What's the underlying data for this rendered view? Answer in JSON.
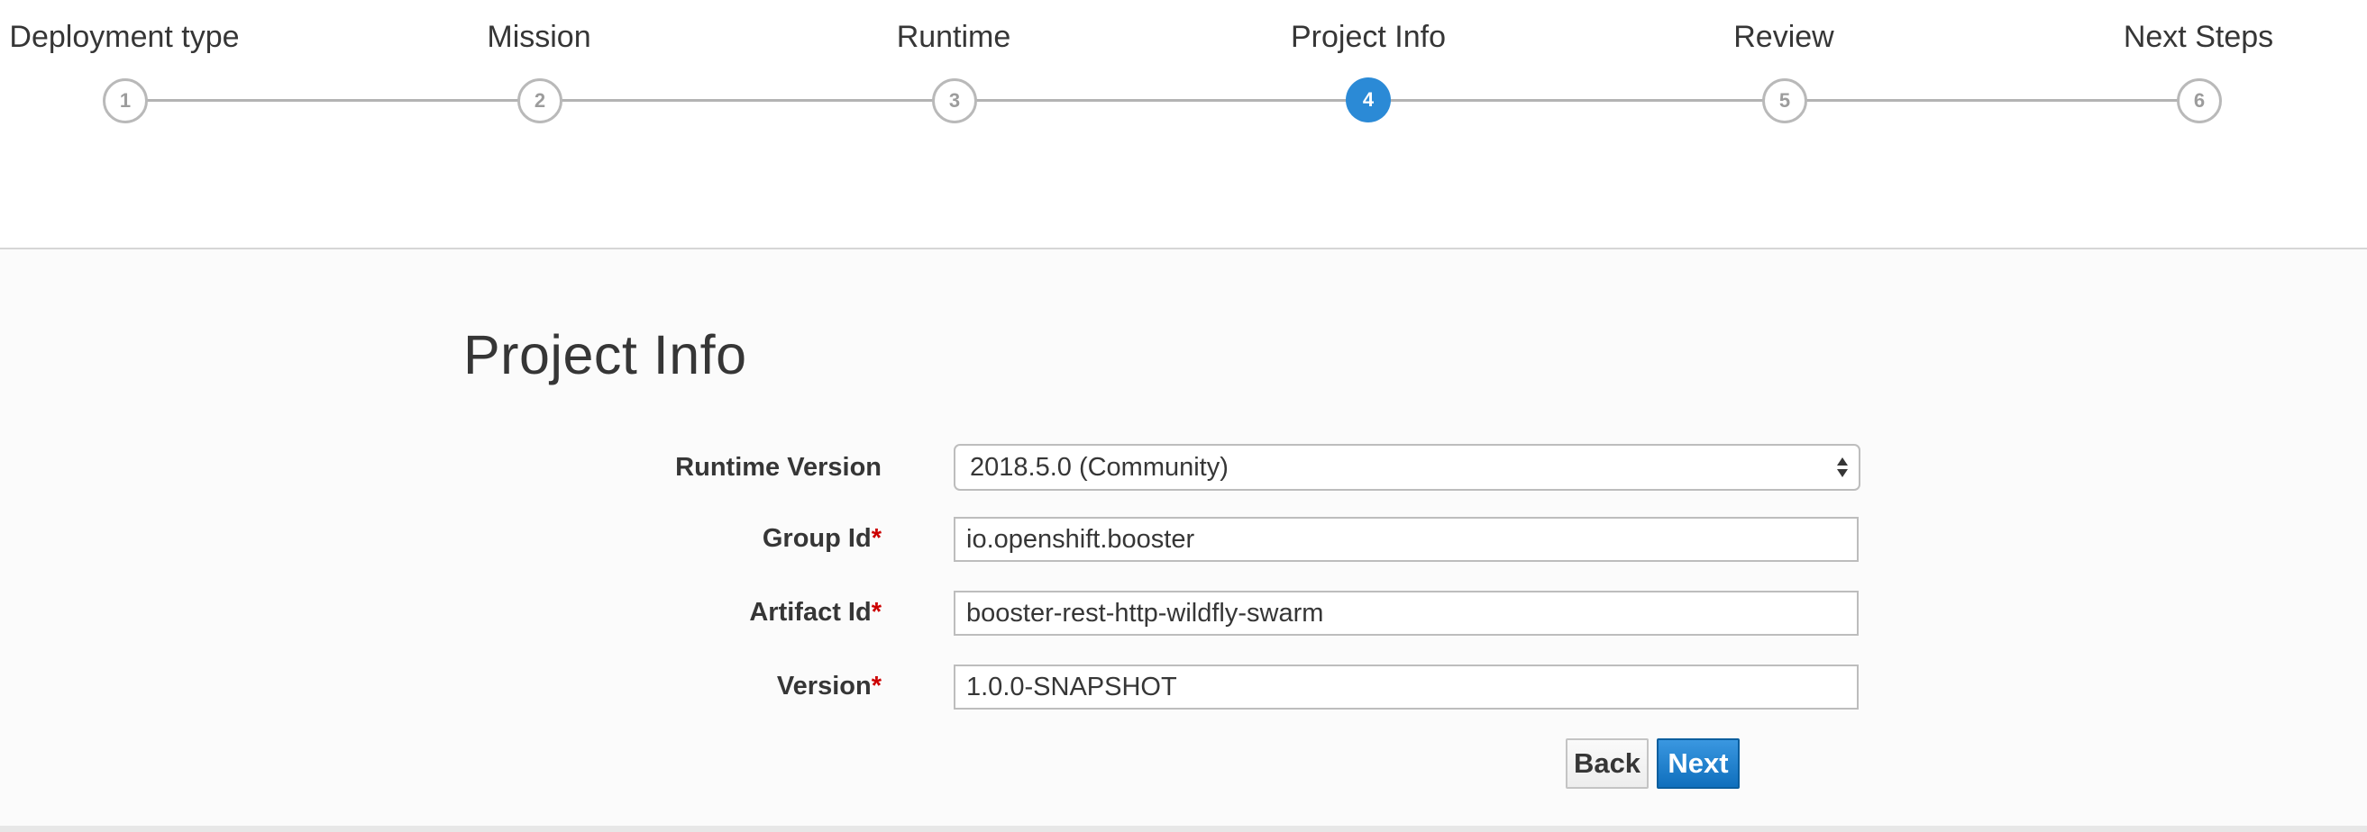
{
  "wizard": {
    "steps": [
      {
        "label": "Deployment type",
        "number": "1",
        "active": false
      },
      {
        "label": "Mission",
        "number": "2",
        "active": false
      },
      {
        "label": "Runtime",
        "number": "3",
        "active": false
      },
      {
        "label": "Project Info",
        "number": "4",
        "active": true
      },
      {
        "label": "Review",
        "number": "5",
        "active": false
      },
      {
        "label": "Next Steps",
        "number": "6",
        "active": false
      }
    ]
  },
  "main": {
    "title": "Project Info",
    "form": {
      "runtime_version": {
        "label": "Runtime Version",
        "value": "2018.5.0 (Community)"
      },
      "group_id": {
        "label": "Group Id",
        "required_mark": "*",
        "value": "io.openshift.booster"
      },
      "artifact_id": {
        "label": "Artifact Id",
        "required_mark": "*",
        "value": "booster-rest-http-wildfly-swarm"
      },
      "version": {
        "label": "Version",
        "required_mark": "*",
        "value": "1.0.0-SNAPSHOT"
      }
    },
    "buttons": {
      "back": "Back",
      "next": "Next"
    }
  },
  "colors": {
    "active_step": "#2b8ad6",
    "inactive_step": "#b9b9b9",
    "primary_button": "#0f6fbd",
    "required": "#cc0000"
  }
}
